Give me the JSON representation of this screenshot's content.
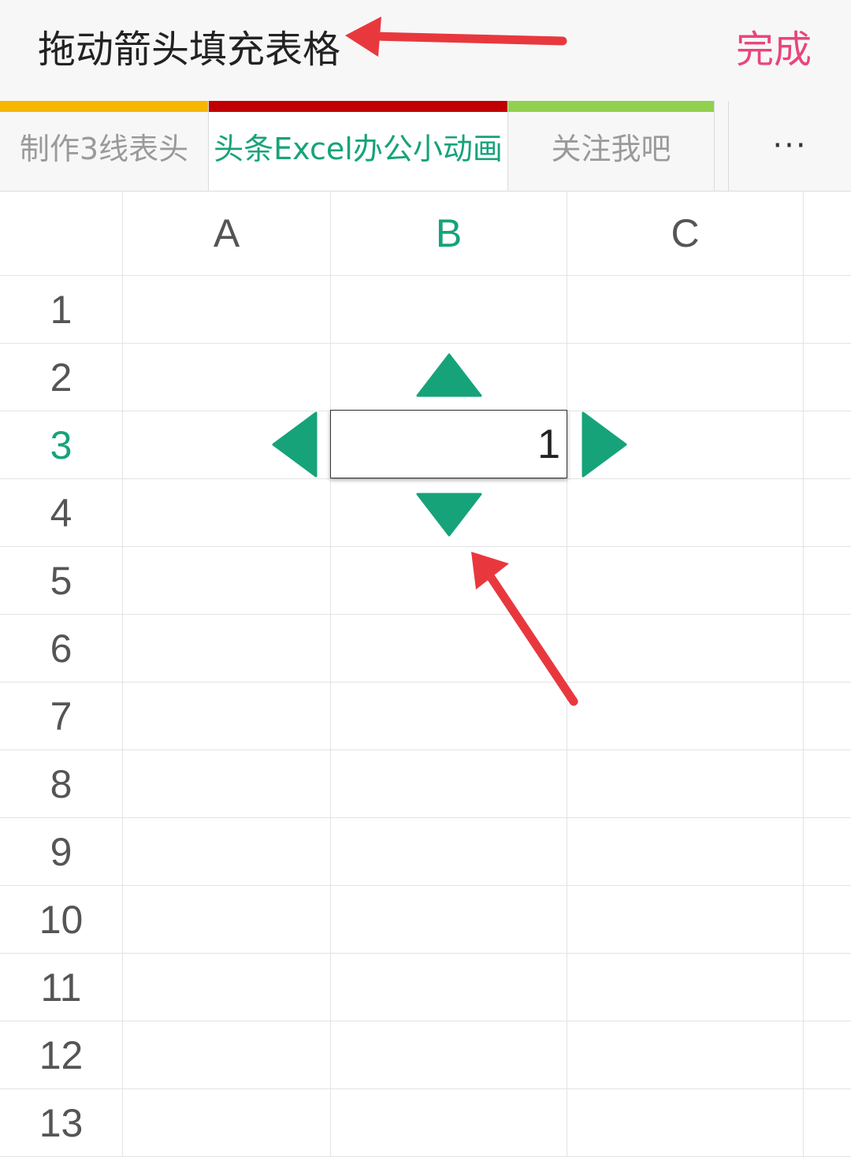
{
  "header": {
    "title": "拖动箭头填充表格",
    "done_label": "完成"
  },
  "tabs": [
    {
      "label": "制作3线表头",
      "color": "#f5b700",
      "active": false
    },
    {
      "label": "头条Excel办公小动画",
      "color": "#c00000",
      "active": true
    },
    {
      "label": "关注我吧",
      "color": "#92d050",
      "active": false
    }
  ],
  "more_label": "···",
  "columns": [
    "A",
    "B",
    "C"
  ],
  "rows": [
    "1",
    "2",
    "3",
    "4",
    "5",
    "6",
    "7",
    "8",
    "9",
    "10",
    "11",
    "12",
    "13"
  ],
  "active_column": "B",
  "active_row": "3",
  "selected_cell": {
    "ref": "B3",
    "value": "1"
  },
  "colors": {
    "accent": "#16a37a",
    "annotation_arrow": "#e8383d",
    "done": "#e9457a"
  }
}
